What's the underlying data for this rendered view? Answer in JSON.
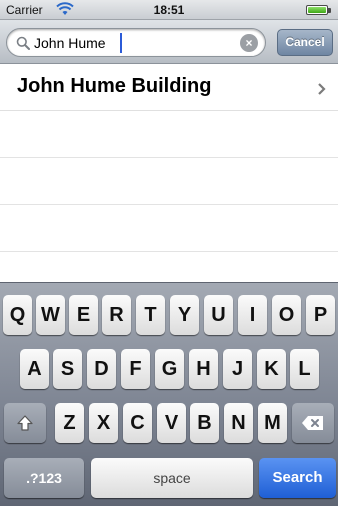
{
  "status_bar": {
    "carrier": "Carrier",
    "time": "18:51",
    "wifi_icon": "wifi-icon",
    "battery_icon": "battery-icon"
  },
  "search": {
    "value": "John Hume",
    "cancel_label": "Cancel",
    "search_icon": "search-icon",
    "clear_icon": "clear-icon"
  },
  "results": [
    {
      "title": "John Hume Building",
      "accessory_icon": "chevron-right-icon"
    }
  ],
  "keyboard": {
    "row1": [
      "Q",
      "W",
      "E",
      "R",
      "T",
      "Y",
      "U",
      "I",
      "O",
      "P"
    ],
    "row2": [
      "A",
      "S",
      "D",
      "F",
      "G",
      "H",
      "J",
      "K",
      "L"
    ],
    "row3": [
      "Z",
      "X",
      "C",
      "V",
      "B",
      "N",
      "M"
    ],
    "shift_icon": "shift-icon",
    "delete_icon": "delete-icon",
    "numbers_label": ".?123",
    "space_label": "space",
    "search_label": "Search"
  },
  "colors": {
    "accent": "#1f5fd5",
    "cancel": "#6f86a3",
    "caret": "#2b5bd8"
  }
}
